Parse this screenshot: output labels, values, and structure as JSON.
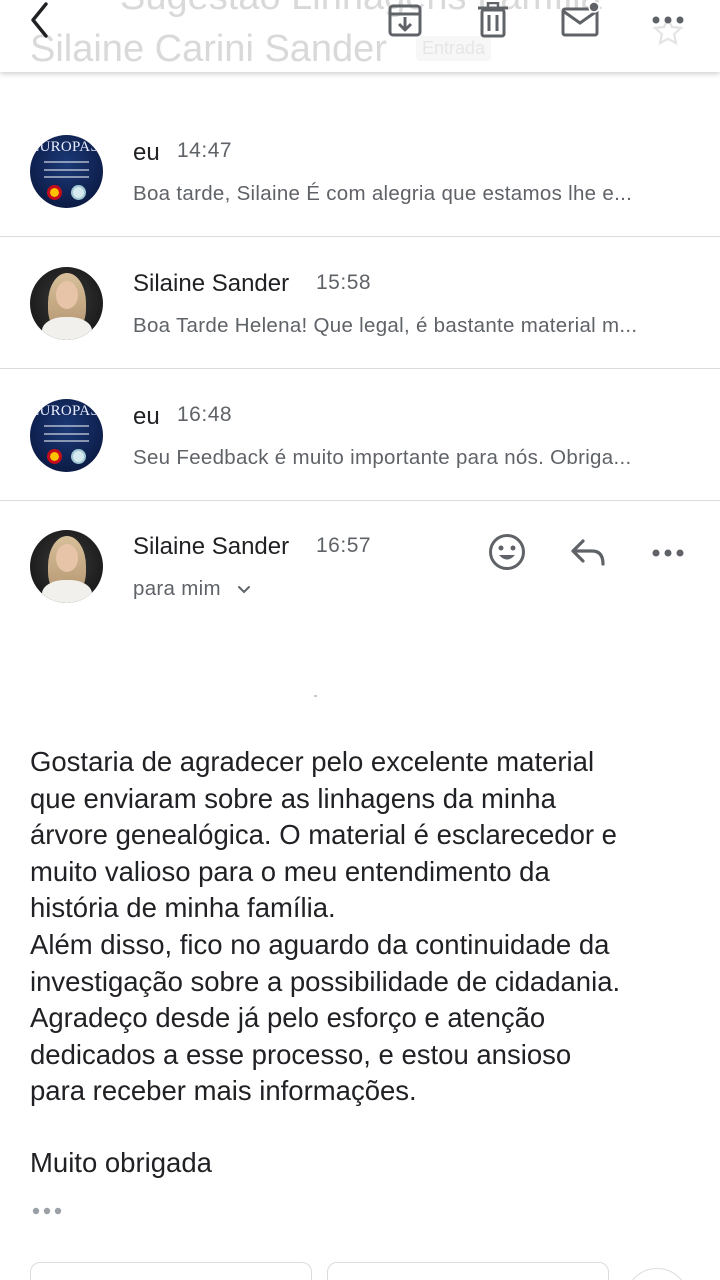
{
  "header": {
    "subject_partial": "Sugestão Linhagens Família",
    "subject_name": "Silaine Carini Sander",
    "label_badge": "Entrada"
  },
  "icons": {
    "back": "chevron-left-icon",
    "archive": "archive-icon",
    "delete": "trash-icon",
    "mark_unread": "mail-unread-icon",
    "more": "more-horizontal-icon",
    "emoji": "emoji-icon",
    "reply": "reply-icon"
  },
  "thread": [
    {
      "sender": "eu",
      "time": "14:47",
      "snippet": "Boa tarde, Silaine É com alegria que estamos lhe e...",
      "avatar": "europass",
      "avatar_text": "EUROPASS"
    },
    {
      "sender": "Silaine Sander",
      "time": "15:58",
      "snippet": "Boa Tarde Helena! Que legal, é bastante material m...",
      "avatar": "person"
    },
    {
      "sender": "eu",
      "time": "16:48",
      "snippet": "Seu Feedback é muito importante para nós. Obriga...",
      "avatar": "europass",
      "avatar_text": "EUROPASS"
    }
  ],
  "open_message": {
    "sender": "Silaine Sander",
    "time": "16:57",
    "recipient": "para mim",
    "body": [
      "Gostaria de agradecer pelo excelente material",
      "que enviaram sobre as linhagens da minha",
      "árvore genealógica. O material é esclarecedor e",
      "muito valioso para o meu entendimento da",
      "história de minha família.",
      "Além disso, fico no aguardo da continuidade da",
      "investigação sobre a possibilidade de cidadania.",
      "Agradeço desde já pelo esforço e atenção",
      "dedicados a esse processo, e estou ansioso",
      "para receber mais informações."
    ],
    "closing": "Muito obrigada",
    "trimmed_content": "•••"
  },
  "colors": {
    "text_primary": "#202124",
    "text_secondary": "#5f6368",
    "divider": "#dcdcdc",
    "icon": "#5f6368"
  }
}
